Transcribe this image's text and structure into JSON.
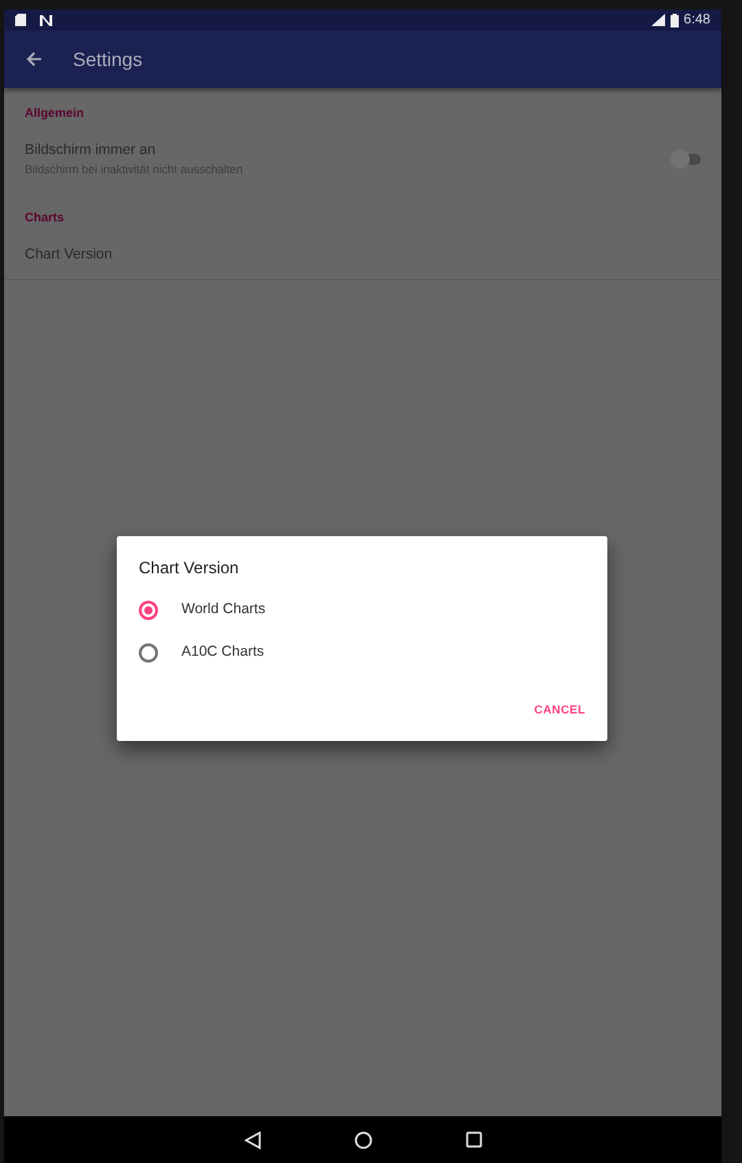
{
  "status_bar": {
    "time": "6:48"
  },
  "app_bar": {
    "title": "Settings"
  },
  "sections": [
    {
      "title": "Allgemein",
      "items": [
        {
          "kind": "switch",
          "title": "Bildschirm immer an",
          "summary": "Bildschirm bei inaktivität nicht ausschalten",
          "on": false
        }
      ]
    },
    {
      "title": "Charts",
      "items": [
        {
          "kind": "plain",
          "title": "Chart Version"
        }
      ]
    }
  ],
  "dialog": {
    "title": "Chart Version",
    "options": [
      {
        "label": "World Charts",
        "selected": true
      },
      {
        "label": "A10C Charts",
        "selected": false
      }
    ],
    "button": "CANCEL"
  }
}
